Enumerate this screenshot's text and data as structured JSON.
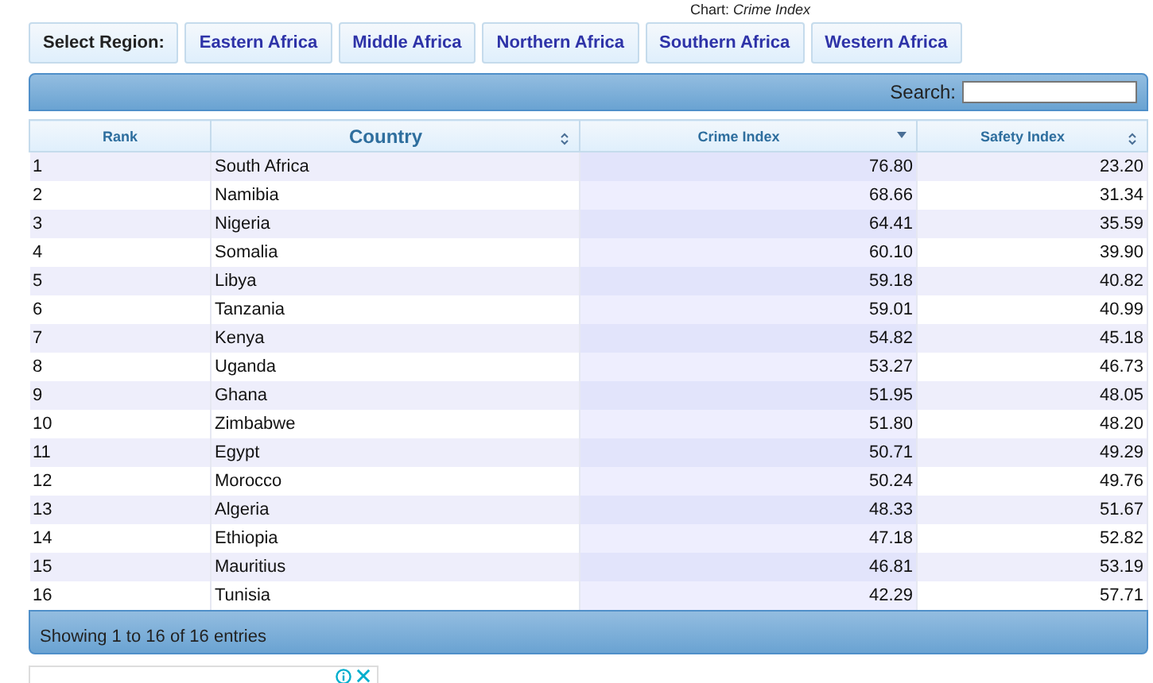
{
  "chart_caption": "Chart: *Crime Index*",
  "region_selector": {
    "label": "Select Region:",
    "regions": [
      "Eastern Africa",
      "Middle Africa",
      "Northern Africa",
      "Southern Africa",
      "Western Africa"
    ]
  },
  "search": {
    "label": "Search:"
  },
  "table": {
    "columns": [
      {
        "label": "Rank",
        "sortable": false,
        "sorted": false
      },
      {
        "label": "Country",
        "sortable": true,
        "sorted": false
      },
      {
        "label": "Crime Index",
        "sortable": true,
        "sorted": true
      },
      {
        "label": "Safety Index",
        "sortable": true,
        "sorted": false
      }
    ],
    "rows": [
      [
        "1",
        "South Africa",
        "76.80",
        "23.20"
      ],
      [
        "2",
        "Namibia",
        "68.66",
        "31.34"
      ],
      [
        "3",
        "Nigeria",
        "64.41",
        "35.59"
      ],
      [
        "4",
        "Somalia",
        "60.10",
        "39.90"
      ],
      [
        "5",
        "Libya",
        "59.18",
        "40.82"
      ],
      [
        "6",
        "Tanzania",
        "59.01",
        "40.99"
      ],
      [
        "7",
        "Kenya",
        "54.82",
        "45.18"
      ],
      [
        "8",
        "Uganda",
        "53.27",
        "46.73"
      ],
      [
        "9",
        "Ghana",
        "51.95",
        "48.05"
      ],
      [
        "10",
        "Zimbabwe",
        "51.80",
        "48.20"
      ],
      [
        "11",
        "Egypt",
        "50.71",
        "49.29"
      ],
      [
        "12",
        "Morocco",
        "50.24",
        "49.76"
      ],
      [
        "13",
        "Algeria",
        "48.33",
        "51.67"
      ],
      [
        "14",
        "Ethiopia",
        "47.18",
        "52.82"
      ],
      [
        "15",
        "Mauritius",
        "46.81",
        "53.19"
      ],
      [
        "16",
        "Tunisia",
        "42.29",
        "57.71"
      ]
    ]
  },
  "footer": "Showing 1 to 16 of 16 entries"
}
